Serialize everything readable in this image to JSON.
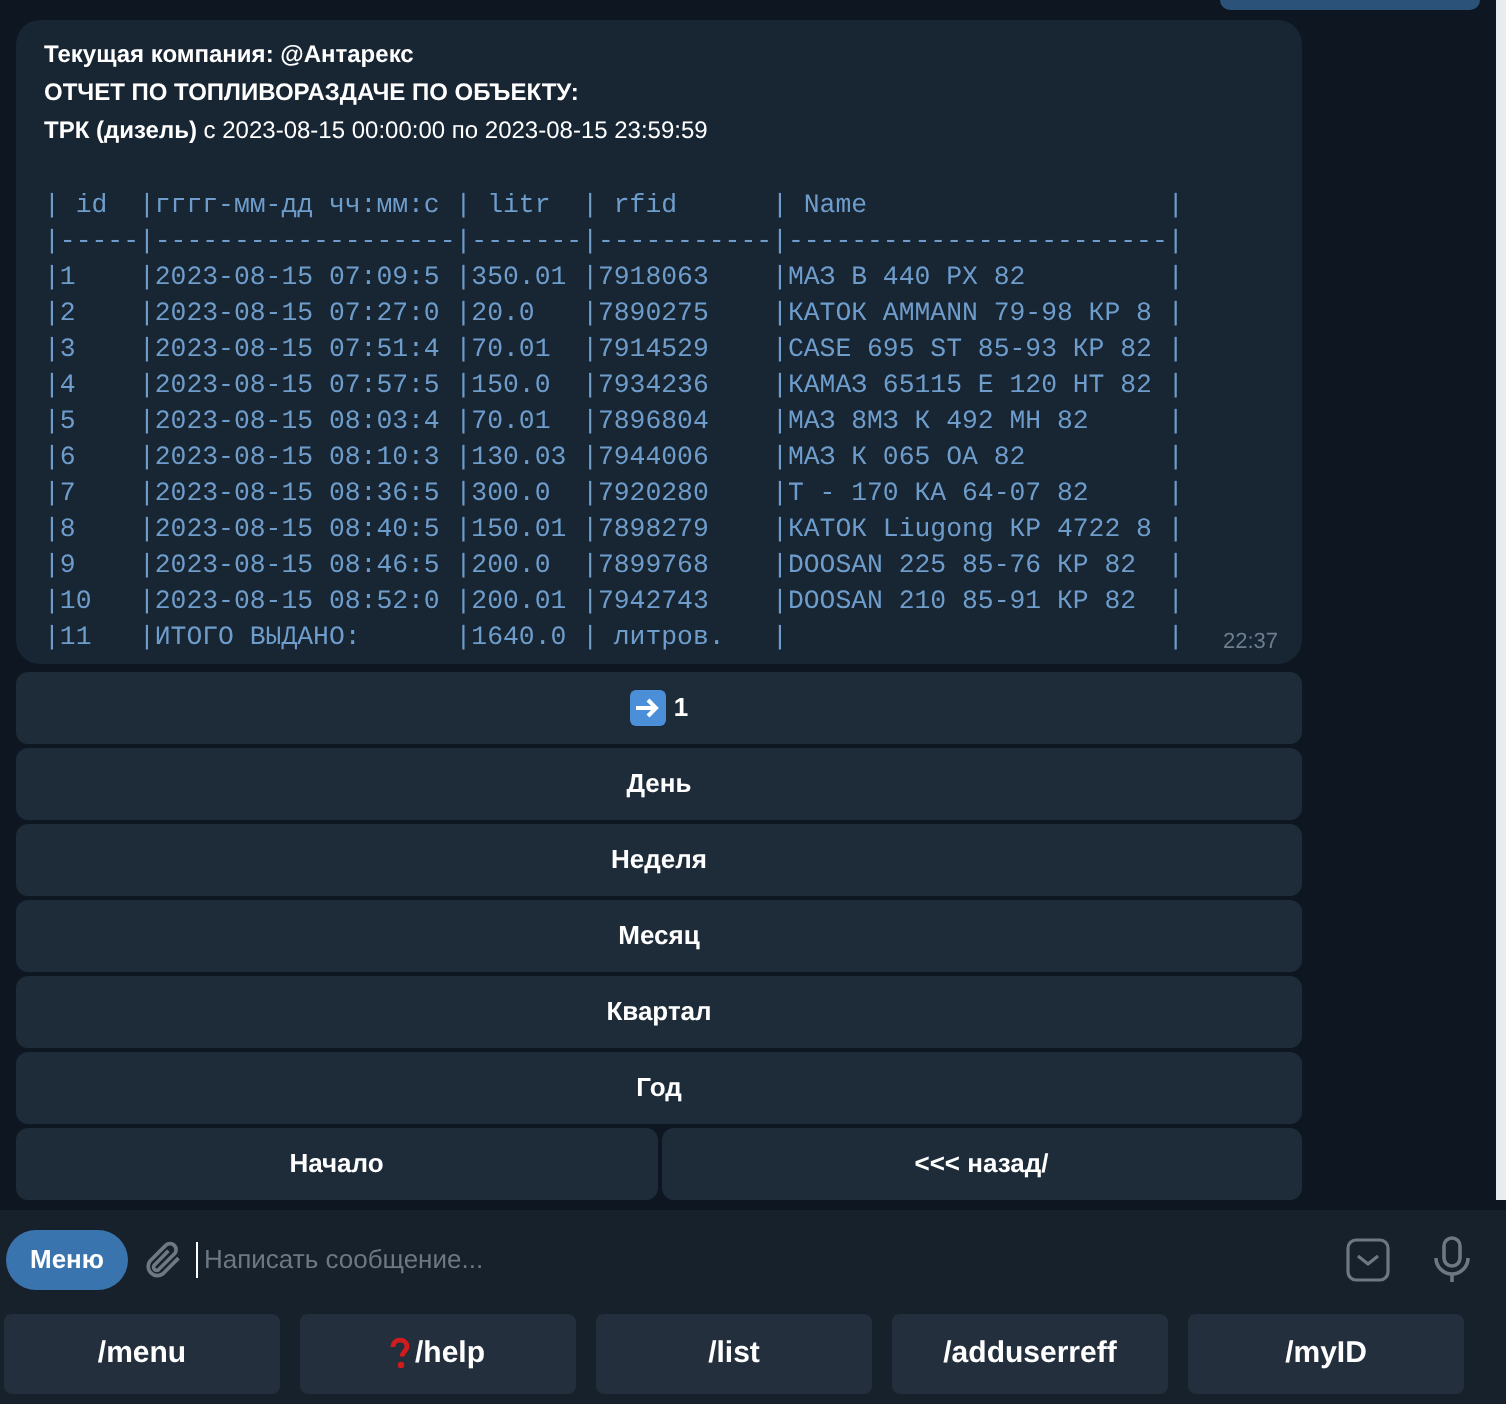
{
  "message": {
    "header_lines": [
      "Текущая компания: @Антарекс",
      "ОТЧЕТ ПО ТОПЛИВОРАЗДАЧЕ ПО ОБЪЕКТУ:",
      "**ТРК (дизель)** с 2023-08-15 00:00:00 по 2023-08-15 23:59:59"
    ],
    "code_lines": [
      "| id  |гггг-мм-дд чч:мм:с | litr  | rfid      | Name                   |",
      "|-----|-------------------|-------|-----------|------------------------|",
      "|1    |2023-08-15 07:09:5 |350.01 |7918063    |МАЗ В 440 РХ 82         |",
      "|2    |2023-08-15 07:27:0 |20.0   |7890275    |КАТОК AMMANN 79-98 КР 8 |",
      "|3    |2023-08-15 07:51:4 |70.01  |7914529    |CASE 695 ST 85-93 КР 82 |",
      "|4    |2023-08-15 07:57:5 |150.0  |7934236    |КАМАЗ 65115 Е 120 НТ 82 |",
      "|5    |2023-08-15 08:03:4 |70.01  |7896804    |МАЗ 8МЗ К 492 МН 82     |",
      "|6    |2023-08-15 08:10:3 |130.03 |7944006    |МАЗ К 065 ОА 82         |",
      "|7    |2023-08-15 08:36:5 |300.0  |7920280    |Т - 170 КА 64-07 82     |",
      "|8    |2023-08-15 08:40:5 |150.01 |7898279    |КАТОК Liugong КР 4722 8 |",
      "|9    |2023-08-15 08:46:5 |200.0  |7899768    |DOOSAN 225 85-76 КР 82  |",
      "|10   |2023-08-15 08:52:0 |200.01 |7942743    |DOOSAN 210 85-91 КР 82  |",
      "|11   |ИТОГО ВЫДАНО:      |1640.0 | литров.   |                        |"
    ],
    "time": "22:37"
  },
  "inline_keyboard": [
    [
      {
        "label": "1",
        "kind": "arrow"
      }
    ],
    [
      {
        "label": "День",
        "kind": "plain"
      }
    ],
    [
      {
        "label": "Неделя",
        "kind": "plain"
      }
    ],
    [
      {
        "label": "Месяц",
        "kind": "plain"
      }
    ],
    [
      {
        "label": "Квартал",
        "kind": "plain"
      }
    ],
    [
      {
        "label": "Год",
        "kind": "plain"
      }
    ],
    [
      {
        "label": "Начало",
        "kind": "plain"
      },
      {
        "label": "<<< назад/",
        "kind": "plain"
      }
    ]
  ],
  "composer": {
    "menu_button": "Меню",
    "placeholder": "Написать сообщение..."
  },
  "reply_keyboard": [
    {
      "label": "/menu",
      "kind": "plain"
    },
    {
      "label": "/help",
      "kind": "question"
    },
    {
      "label": "/list",
      "kind": "plain"
    },
    {
      "label": "/adduserreff",
      "kind": "plain"
    },
    {
      "label": "/myID",
      "kind": "plain"
    }
  ]
}
